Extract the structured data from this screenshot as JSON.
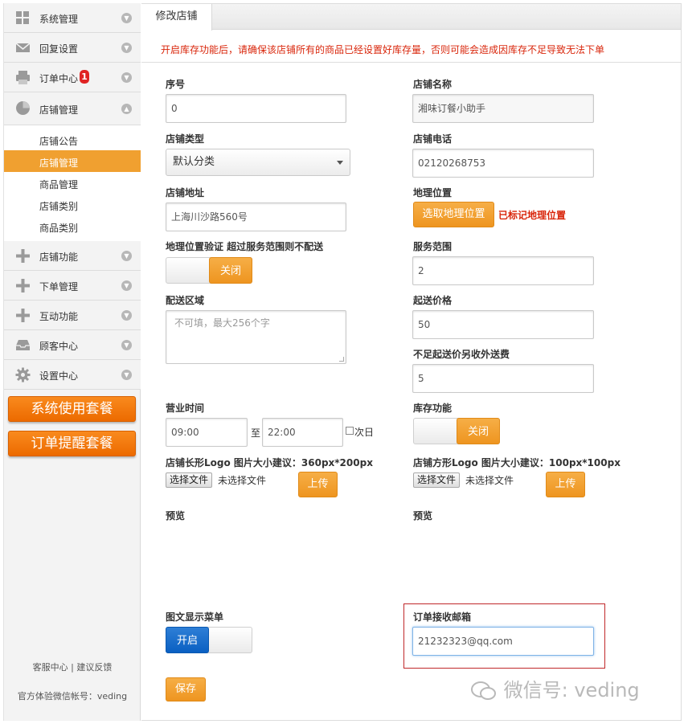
{
  "sidebar": {
    "menu": [
      {
        "label": "系统管理",
        "icon": "grid-icon"
      },
      {
        "label": "回复设置",
        "icon": "mail-icon"
      },
      {
        "label": "订单中心",
        "icon": "printer-icon",
        "badge": "1"
      },
      {
        "label": "店铺管理",
        "icon": "pie-chart-icon"
      }
    ],
    "submenu": [
      "店铺公告",
      "店铺管理",
      "商品管理",
      "店铺类别",
      "商品类别"
    ],
    "menu2": [
      {
        "label": "店铺功能",
        "icon": "plus-icon"
      },
      {
        "label": "下单管理",
        "icon": "plus-icon"
      },
      {
        "label": "互动功能",
        "icon": "plus-icon"
      },
      {
        "label": "顾客中心",
        "icon": "inbox-icon"
      },
      {
        "label": "设置中心",
        "icon": "gear-icon"
      }
    ],
    "packages": [
      "系统使用套餐",
      "订单提醒套餐"
    ],
    "links": {
      "service": "客服中心",
      "sep": "|",
      "feedback": "建议反馈"
    },
    "wechat_account": "官方体验微信帐号：veding"
  },
  "main": {
    "tab": "修改店铺",
    "warning": "开启库存功能后，请确保该店铺所有的商品已经设置好库存量，否则可能会造成因库存不足导致无法下单",
    "form": {
      "seq_label": "序号",
      "seq_value": "0",
      "name_label": "店铺名称",
      "name_value": "湘味订餐小助手",
      "type_label": "店铺类型",
      "type_value": "默认分类",
      "phone_label": "店铺电话",
      "phone_value": "02120268753",
      "address_label": "店铺地址",
      "address_value": "上海川沙路560号",
      "geo_label": "地理位置",
      "geo_button": "选取地理位置",
      "geo_status": "已标记地理位置",
      "geo_verify_label": "地理位置验证 超过服务范围则不配送",
      "geo_verify_toggle": "关闭",
      "range_label": "服务范围",
      "range_value": "2",
      "area_label": "配送区域",
      "area_placeholder": "不可填，最大256个字",
      "min_price_label": "起送价格",
      "min_price_value": "50",
      "extra_fee_label": "不足起送价另收外送费",
      "extra_fee_value": "5",
      "hours_label": "营业时间",
      "hours_from": "09:00",
      "hours_to_sep": "至",
      "hours_to": "22:00",
      "next_day_label": "次日",
      "stock_label": "库存功能",
      "stock_toggle": "关闭",
      "logo_wide_label": "店铺长形Logo 图片大小建议：360px*200px",
      "logo_square_label": "店铺方形Logo 图片大小建议：100px*100px",
      "choose_file": "选择文件",
      "no_file": "未选择文件",
      "upload": "上传",
      "preview_label": "预览",
      "menu_display_label": "图文显示菜单",
      "menu_display_toggle": "开启",
      "email_label": "订单接收邮箱",
      "email_value": "21232323@qq.com",
      "save": "保存"
    }
  },
  "watermark": "微信号: veding",
  "colors": {
    "accent_orange": "#ee9520",
    "package_orange": "#ec6a00",
    "warning_red": "#d9260b",
    "toggle_blue": "#0a60c2",
    "highlight_box": "#c0282a"
  }
}
